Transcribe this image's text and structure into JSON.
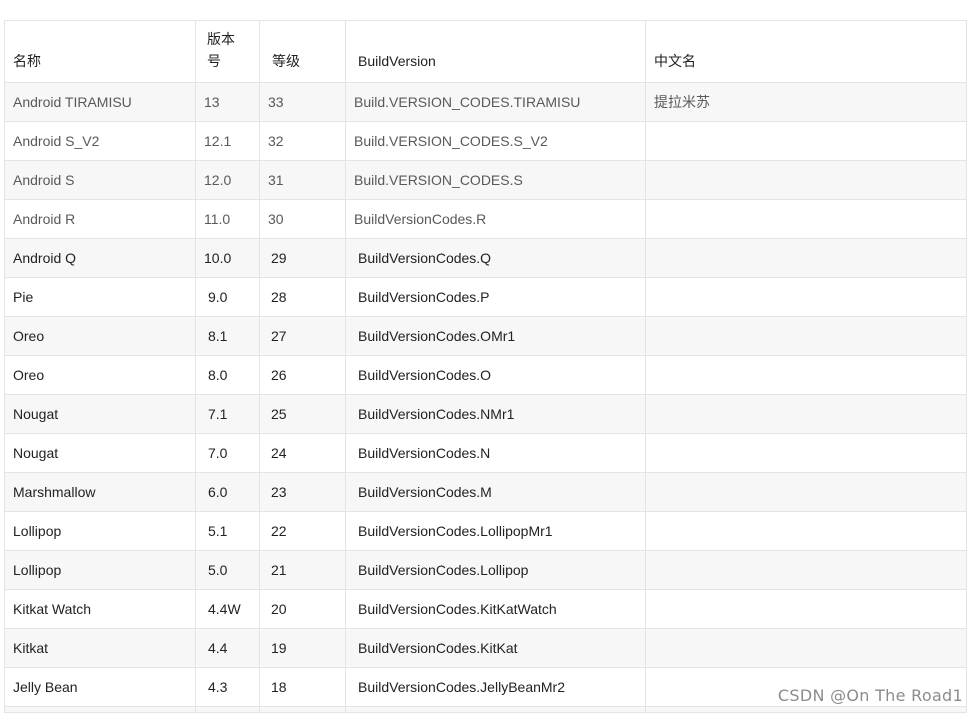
{
  "table": {
    "headers": {
      "name": "名称",
      "version": "版本号",
      "level": "等级",
      "build_version": "BuildVersion",
      "chinese_name": "中文名"
    },
    "rows": [
      {
        "name": "Android TIRAMISU",
        "version": "13",
        "level": "33",
        "code": "Build.VERSION_CODES.TIRAMISU",
        "cn": "提拉米苏"
      },
      {
        "name": "Android S_V2",
        "version": "12.1",
        "level": "32",
        "code": "Build.VERSION_CODES.S_V2",
        "cn": ""
      },
      {
        "name": "Android S",
        "version": "12.0",
        "level": "31",
        "code": "Build.VERSION_CODES.S",
        "cn": ""
      },
      {
        "name": "Android R",
        "version": "11.0",
        "level": "30",
        "code": "BuildVersionCodes.R",
        "cn": ""
      },
      {
        "name": "Android Q",
        "version": "10.0",
        "level": "29",
        "code": "BuildVersionCodes.Q",
        "cn": ""
      },
      {
        "name": "Pie",
        "version": "9.0",
        "level": "28",
        "code": "BuildVersionCodes.P",
        "cn": ""
      },
      {
        "name": "Oreo",
        "version": "8.1",
        "level": "27",
        "code": "BuildVersionCodes.OMr1",
        "cn": ""
      },
      {
        "name": "Oreo",
        "version": "8.0",
        "level": "26",
        "code": "BuildVersionCodes.O",
        "cn": ""
      },
      {
        "name": "Nougat",
        "version": "7.1",
        "level": "25",
        "code": "BuildVersionCodes.NMr1",
        "cn": ""
      },
      {
        "name": "Nougat",
        "version": "7.0",
        "level": "24",
        "code": "BuildVersionCodes.N",
        "cn": ""
      },
      {
        "name": "Marshmallow",
        "version": "6.0",
        "level": "23",
        "code": "BuildVersionCodes.M",
        "cn": ""
      },
      {
        "name": "Lollipop",
        "version": "5.1",
        "level": "22",
        "code": "BuildVersionCodes.LollipopMr1",
        "cn": ""
      },
      {
        "name": "Lollipop",
        "version": "5.0",
        "level": "21",
        "code": "BuildVersionCodes.Lollipop",
        "cn": ""
      },
      {
        "name": "Kitkat Watch",
        "version": "4.4W",
        "level": "20",
        "code": "BuildVersionCodes.KitKatWatch",
        "cn": ""
      },
      {
        "name": "Kitkat",
        "version": "4.4",
        "level": "19",
        "code": "BuildVersionCodes.KitKat",
        "cn": ""
      },
      {
        "name": "Jelly Bean",
        "version": "4.3",
        "level": "18",
        "code": "BuildVersionCodes.JellyBeanMr2",
        "cn": ""
      }
    ]
  },
  "watermark": "CSDN @On The Road1"
}
